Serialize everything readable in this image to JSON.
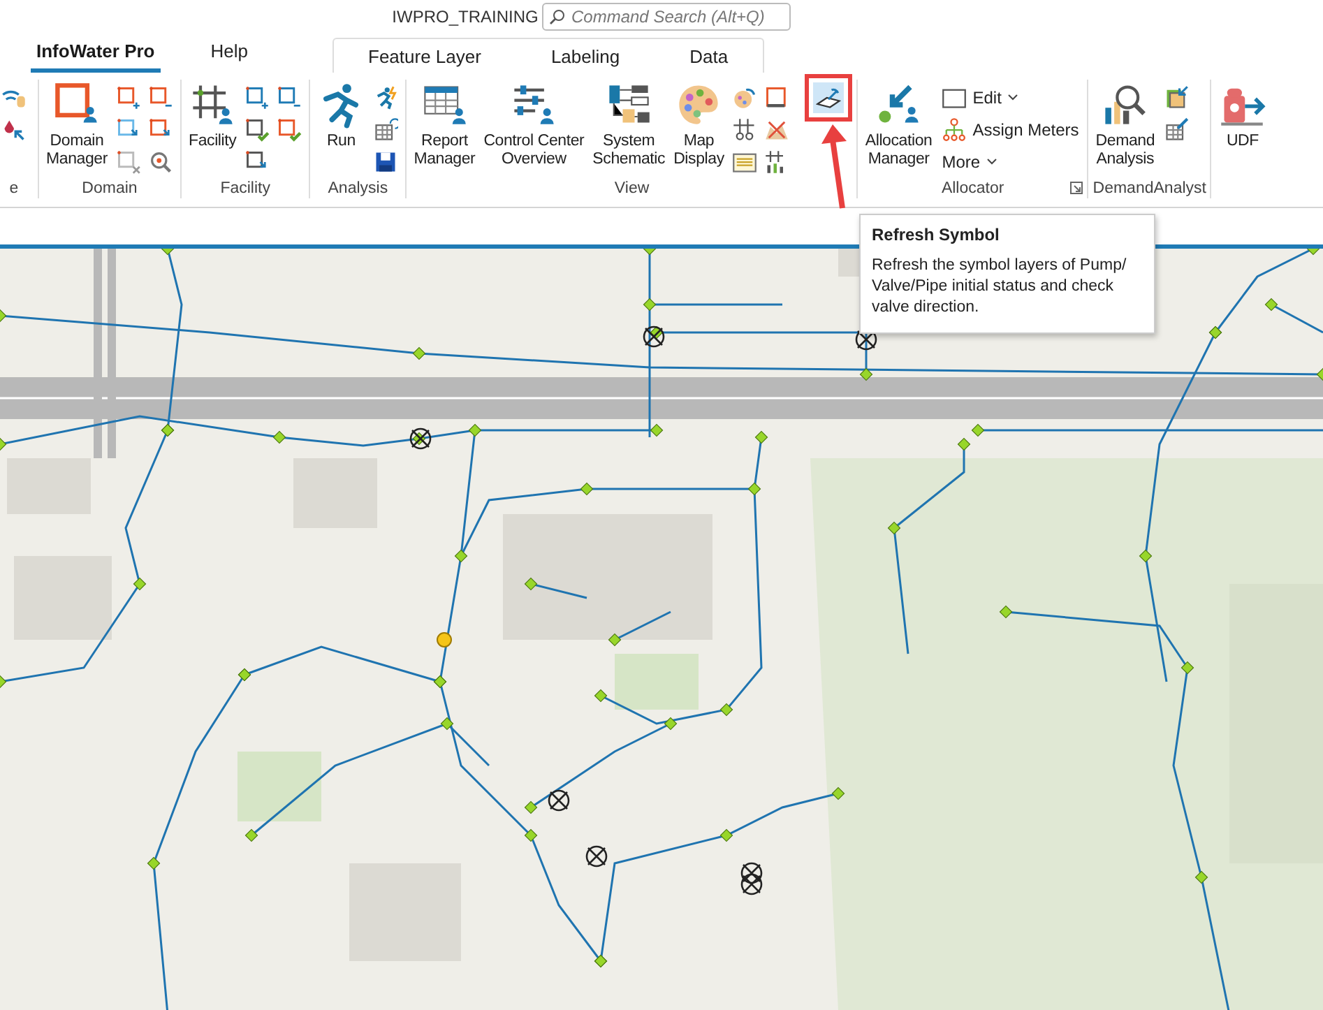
{
  "title_bar": {
    "title": "IWPRO_TRAINING",
    "search": {
      "placeholder": "Command Search (Alt+Q)"
    }
  },
  "tabs": [
    {
      "label": "InfoWater Pro",
      "selected": true
    },
    {
      "label": "Help",
      "selected": false
    }
  ],
  "contextual_tabs": [
    {
      "label": "Feature Layer",
      "selected": false
    },
    {
      "label": "Labeling",
      "selected": false
    },
    {
      "label": "Data",
      "selected": false
    }
  ],
  "ribbon": {
    "groups": [
      {
        "label": "e",
        "small_buttons": [
          {
            "hovered": false
          },
          {
            "hovered": false
          }
        ]
      },
      {
        "label": "Domain",
        "large_buttons": [
          {
            "label": "Domain\nManager"
          }
        ],
        "small_buttons": [
          {
            "hovered": false
          },
          {
            "hovered": false
          },
          {
            "hovered": false
          },
          {
            "hovered": false
          },
          {
            "hovered": false
          },
          {
            "hovered": false
          }
        ]
      },
      {
        "label": "Facility",
        "large_buttons": [
          {
            "label": "Facility"
          }
        ],
        "small_buttons": [
          {
            "hovered": false
          },
          {
            "hovered": false
          },
          {
            "hovered": false
          },
          {
            "hovered": false
          },
          {
            "hovered": false
          }
        ]
      },
      {
        "label": "Analysis",
        "large_buttons": [
          {
            "label": "Run"
          }
        ],
        "small_buttons": [
          {
            "hovered": false
          },
          {
            "hovered": false
          },
          {
            "hovered": false
          }
        ]
      },
      {
        "label": "View",
        "large_buttons": [
          {
            "label": "Report\nManager"
          },
          {
            "label": "Control Center\nOverview"
          },
          {
            "label": "System\nSchematic"
          },
          {
            "label": "Map\nDisplay"
          }
        ],
        "small_buttons": [
          {
            "hovered": false
          },
          {
            "hovered": false
          },
          {
            "hovered": false
          },
          {
            "hovered": false
          },
          {
            "hovered": false
          },
          {
            "hovered": false
          },
          {
            "hovered": true
          }
        ]
      },
      {
        "label": "Allocator",
        "launcher": true,
        "large_buttons": [
          {
            "label": "Allocation\nManager"
          }
        ],
        "small_buttons": [
          {
            "label": "Edit",
            "dropdown": true,
            "hovered": false
          },
          {
            "label": "Assign Meters",
            "dropdown": false,
            "hovered": false
          },
          {
            "label": "More",
            "dropdown": true,
            "hovered": false
          }
        ]
      },
      {
        "label": "DemandAnalyst",
        "large_buttons": [
          {
            "label": "Demand\nAnalysis"
          }
        ],
        "small_buttons": [
          {
            "hovered": false
          },
          {
            "hovered": false
          }
        ]
      },
      {
        "large_buttons": [
          {
            "label": "UDF"
          }
        ]
      }
    ]
  },
  "tooltip": {
    "title": "Refresh Symbol",
    "text": "Refresh the symbol layers of Pump/ Valve/Pipe initial status and check valve direction."
  },
  "callout": {
    "shown": true
  }
}
